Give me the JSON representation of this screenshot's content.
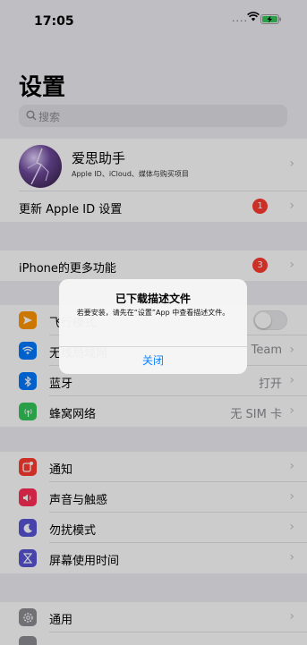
{
  "status_bar": {
    "time": "17:05",
    "signal": "....",
    "wifi_icon": "wifi-icon",
    "battery_icon": "battery-charging-icon"
  },
  "page_title": "设置",
  "search": {
    "placeholder": "搜索",
    "icon": "search-icon"
  },
  "profile": {
    "name": "爱思助手",
    "subtitle": "Apple ID、iCloud、媒体与购买项目",
    "chevron": "›"
  },
  "apple_id_update": {
    "label": "更新 Apple ID 设置",
    "badge": "1",
    "chevron": "›"
  },
  "more_features": {
    "label": "iPhone的更多功能",
    "badge": "3",
    "chevron": "›"
  },
  "connectivity": [
    {
      "label": "飞行模式",
      "icon": "airplane-icon",
      "color": "#ff9500",
      "value": "",
      "toggle": false
    },
    {
      "label": "无线局域网",
      "icon": "wifi-icon",
      "color": "#007aff",
      "value": "Team",
      "chevron": "›"
    },
    {
      "label": "蓝牙",
      "icon": "bluetooth-icon",
      "color": "#007aff",
      "value": "打开",
      "chevron": "›"
    },
    {
      "label": "蜂窝网络",
      "icon": "cellular-icon",
      "color": "#34c759",
      "value": "无 SIM 卡",
      "chevron": "›"
    }
  ],
  "notifications_group": [
    {
      "label": "通知",
      "icon": "notifications-icon",
      "color": "#ff3b30",
      "chevron": "›"
    },
    {
      "label": "声音与触感",
      "icon": "speaker-icon",
      "color": "#ff2d55",
      "chevron": "›"
    },
    {
      "label": "勿扰模式",
      "icon": "moon-icon",
      "color": "#5856d6",
      "chevron": "›"
    },
    {
      "label": "屏幕使用时间",
      "icon": "hourglass-icon",
      "color": "#5856d6",
      "chevron": "›"
    }
  ],
  "general_group": [
    {
      "label": "通用",
      "icon": "gear-icon",
      "color": "#8e8e93",
      "chevron": "›"
    }
  ],
  "alert": {
    "title": "已下载描述文件",
    "message": "若要安装，请先在“设置”App 中查看描述文件。",
    "button": "关闭",
    "button_color": "#0a84ff"
  }
}
